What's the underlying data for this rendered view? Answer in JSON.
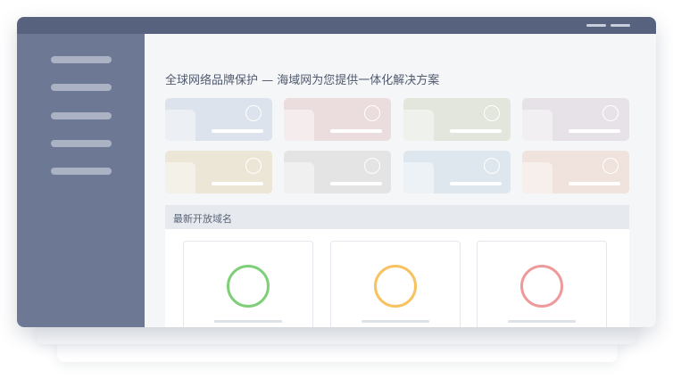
{
  "window": {
    "controls": [
      {
        "name": "minimize-control-icon"
      },
      {
        "name": "close-control-icon"
      }
    ]
  },
  "sidebar": {
    "items": [
      {
        "label": ""
      },
      {
        "label": ""
      },
      {
        "label": ""
      },
      {
        "label": ""
      },
      {
        "label": ""
      }
    ]
  },
  "main": {
    "title": "全球网络品牌保护 — 海域网为您提供一体化解决方案",
    "tiles": [
      {
        "color": "#dde3ec"
      },
      {
        "color": "#ebdcde"
      },
      {
        "color": "#e2e6dc"
      },
      {
        "color": "#e6e2e8"
      },
      {
        "color": "#ebe6d6"
      },
      {
        "color": "#e4e4e4"
      },
      {
        "color": "#dde7ed"
      },
      {
        "color": "#f0e2dc"
      }
    ]
  },
  "latest_domains": {
    "title": "最新开放域名",
    "cards": [
      {
        "accent": "#7fcf78"
      },
      {
        "accent": "#f7c25f"
      },
      {
        "accent": "#ee9a9a"
      }
    ]
  }
}
